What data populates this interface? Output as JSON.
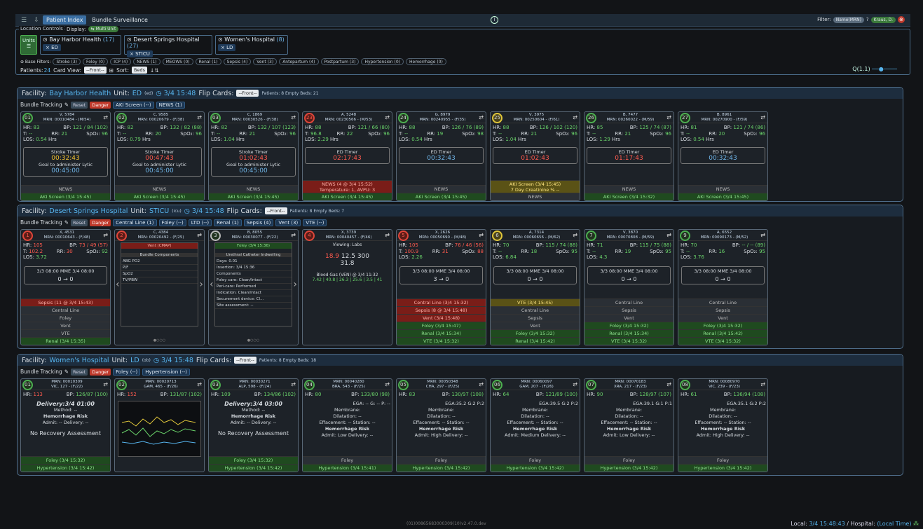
{
  "topbar": {
    "menu_icon": "hamburger-icon",
    "pin_icon": "pin-icon",
    "tab_patient": "Patient Index",
    "tab_bundle": "Bundle Surveillance",
    "info": "i",
    "filter_label": "Filter:",
    "filter_placeholder": "Name(MRN)",
    "help": "?",
    "user": "Kraus, D.",
    "close": "⊗"
  },
  "loc": {
    "legend": "Location Controls",
    "display_label": "Display:",
    "multi_unit": "⇆ Multi Unit",
    "units_label": "Units",
    "facilities": [
      {
        "name": "⊙ Bay Harbor Health",
        "count": "(17)",
        "unit": "× ED"
      },
      {
        "name": "⊙ Desert Springs Hospital",
        "count": "(27)",
        "unit": "× STICU"
      },
      {
        "name": "⊙ Women's Hospital",
        "count": "(8)",
        "unit": "× LD"
      }
    ],
    "base_filters_label": "⊕ Base Filters:",
    "filters": [
      "Stroke (3)",
      "Foley (0)",
      "ICP (4)",
      "NEWS (1)",
      "MEOWS (0)",
      "Renal (1)",
      "Sepsis (4)",
      "Vent (3)",
      "Antepartum (4)",
      "Postpartum (3)",
      "Hypertension (0)",
      "Hemorrhage (0)"
    ],
    "patients_label": "Patients:",
    "patients_count": "24",
    "card_view_label": "Card View:",
    "card_view": "--Front--",
    "sort_label": "Sort:",
    "sort": "Beds",
    "zoom": "Q(1.1)"
  },
  "fac1": {
    "label": "Facility:",
    "name": "Bay Harbor Health",
    "unit_label": "Unit:",
    "unit": "ED",
    "unit_code": "(ed)",
    "time": "◷ 3/4 15:48",
    "flip": "Flip Cards:",
    "flip_val": "--Front--",
    "meta": "Patients: 8 Empty Beds: 21",
    "bundle": "Bundle Tracking",
    "reset": "Reset",
    "danger": "Danger",
    "chips": [
      "AKI Screen (--)",
      "NEWS (1)"
    ],
    "cards": [
      {
        "bed": "01",
        "id": "V, 5784",
        "mrn": "MRN: 00010484 - (M/54)",
        "hr": "83",
        "bp": "121 / 84 (102)",
        "t": "--",
        "rr": "21",
        "spo2": "96",
        "los": "0.54",
        "timer_title": "Stroke Timer",
        "timer": "00:32:43",
        "goal": "Goal to administer Lytic",
        "goal_t": "00:45:00",
        "s1": "NEWS",
        "s2": "AKI Screen (3/4 15:45)"
      },
      {
        "bed": "02",
        "id": "C, 9585",
        "mrn": "MRN: 00020679 - (F/38)",
        "hr": "82",
        "bp": "132 / 82 (88)",
        "t": "--",
        "rr": "20",
        "spo2": "96",
        "los": "0.79",
        "timer_title": "Stroke Timer",
        "timer": "00:47:43",
        "goal": "Goal to administer Lytic",
        "goal_t": "00:45:00",
        "s1": "NEWS",
        "s2": "AKI Screen (3/4 15:45)"
      },
      {
        "bed": "03",
        "id": "C, 1869",
        "mrn": "MRN: 00030526 - (F/38)",
        "hr": "82",
        "bp": "132 / 107 (123)",
        "t": "--",
        "rr": "21",
        "spo2": "96",
        "los": "1.04",
        "timer_title": "Stroke Timer",
        "timer": "01:02:43",
        "goal": "Goal to administer Lytic",
        "goal_t": "00:45:00",
        "s1": "NEWS",
        "s2": "AKI Screen (3/4 15:45)"
      },
      {
        "bed": "23",
        "id": "A, 5248",
        "mrn": "MRN: 00230566 - (M/53)",
        "hr": "88",
        "bp": "121 / 66 (80)",
        "t": "96.8",
        "rr": "22",
        "spo2": "96",
        "los": "2.29",
        "timer_title": "ED Timer",
        "timer": "02:17:43",
        "goal": "",
        "goal_t": "",
        "s1": "NEWS (4 @ 3/4 15:52)",
        "s1b": "Temperature: 1, AVPU: 3",
        "s2": "AKI Screen (3/4 15:45)"
      },
      {
        "bed": "24",
        "id": "G, 8979",
        "mrn": "MRN: 00240955 - (F/35)",
        "hr": "88",
        "bp": "126 / 76 (89)",
        "t": "--",
        "rr": "19",
        "spo2": "98",
        "los": "0.54",
        "timer_title": "ED Timer",
        "timer": "00:32:43",
        "goal": "",
        "goal_t": "",
        "s1": "NEWS",
        "s2": "AKI Screen (3/4 15:45)"
      },
      {
        "bed": "25",
        "id": "V, 3975",
        "mrn": "MRN: 00250604 - (F/61)",
        "hr": "88",
        "bp": "126 / 102 (120)",
        "t": "--",
        "rr": "21",
        "spo2": "96",
        "los": "1.04",
        "timer_title": "ED Timer",
        "timer": "01:02:43",
        "goal": "",
        "goal_t": "",
        "s1": "AKI Screen (3/4 15:45)",
        "s1b": "7 Day Creatinine % --",
        "s2": "NEWS"
      },
      {
        "bed": "26",
        "id": "B, 7477",
        "mrn": "MRN: 00260022 - (M/59)",
        "hr": "85",
        "bp": "125 / 74 (87)",
        "t": "--",
        "rr": "21",
        "spo2": "96",
        "los": "1.29",
        "timer_title": "ED Timer",
        "timer": "01:17:43",
        "goal": "",
        "goal_t": "",
        "s1": "NEWS",
        "s2": "AKI Screen (3/4 15:32)"
      },
      {
        "bed": "27",
        "id": "B, 8961",
        "mrn": "MRN: 00270900 - (F/59)",
        "hr": "81",
        "bp": "121 / 74 (86)",
        "t": "--",
        "rr": "20",
        "spo2": "96",
        "los": "0.54",
        "timer_title": "ED Timer",
        "timer": "00:32:43",
        "goal": "",
        "goal_t": "",
        "s1": "NEWS",
        "s2": "AKI Screen (3/4 15:45)"
      }
    ]
  },
  "fac2": {
    "label": "Facility:",
    "name": "Desert Springs Hospital",
    "unit_label": "Unit:",
    "unit": "STICU",
    "unit_code": "(icu)",
    "time": "◷ 3/4 15:48",
    "flip": "Flip Cards:",
    "flip_val": "--Front--",
    "meta": "Patients: 8 Empty Beds: 7",
    "bundle": "Bundle Tracking",
    "reset": "Reset",
    "danger": "Danger",
    "chips": [
      "Central Line (1)",
      "Foley (--)",
      "LTD (--)",
      "Renal (1)",
      "Sepsis (4)",
      "Vent (3)",
      "VTE (--)"
    ],
    "cards": [
      {
        "bed": "1",
        "id": "X, 4531",
        "mrn": "MRN: 00010643 - (F/48)",
        "hr": "105",
        "bp": "73 / 49 (57)",
        "t": "102.2",
        "rr": "30",
        "spo2": "92",
        "los": "3.72",
        "mme": "3/3 08:00 MME 3/4 08:00",
        "mmev": "0 → 0",
        "rows": [
          "Sepsis (11 @ 3/4 15:43)",
          "Central Line",
          "Foley",
          "Vent",
          "VTE",
          "Renal (3/4 15:35)"
        ]
      },
      {
        "bed": "2",
        "id": "C, 4384",
        "mrn": "MRN: 00020492 - (F/25)",
        "panel": "Vent (CMAP)",
        "panel2": "Bundle Components",
        "rows": [
          "ABG PO2",
          "P/F",
          "SpO2",
          "TV/PBW"
        ]
      },
      {
        "bed": "3",
        "id": "B, 8055",
        "mrn": "MRN: 00030077 - (F/22)",
        "panel": "Foley (3/4 15:36)",
        "panel2": "Urethral Catheter Indwelling",
        "rows": [
          "Days: 0.01",
          "Insertion: 3/4 15:36",
          "Components",
          "Foley care: Clean/Intact",
          "Peri-care: Performed",
          "Indication: Clean/Intact",
          "Securement device: Cl...",
          "Site assessment: --"
        ]
      },
      {
        "bed": "4",
        "id": "X, 3739",
        "mrn": "MRN: 00040457 - (F/46)",
        "panel": "Viewing: Labs",
        "labs": [
          "18.9",
          "12.5",
          "300",
          "31.8"
        ],
        "labline": "Blood Gas (VEN) @ 3/4 11:32",
        "labvals": "7.42 | 40.8 | 26.3 | 25.6 | 3.5 | 41"
      },
      {
        "bed": "5",
        "id": "X, 2626",
        "mrn": "MRN: 00050690 - (M/48)",
        "hr": "105",
        "bp": "76 / 46 (56)",
        "t": "100.9",
        "rr": "31",
        "spo2": "88",
        "los": "2.26",
        "mme": "3/3 08:00 MME 3/4 08:00",
        "mmev": "3 → 0",
        "rows": [
          "Central Line (3/4 15:32)",
          "Sepsis (8 @ 3/4 15:48)",
          "Vent (3/4 15:48)",
          "Foley (3/4 15:47)",
          "Renal (3/4 15:34)",
          "VTE (3/4 15:32)"
        ]
      },
      {
        "bed": "6",
        "id": "A, 7314",
        "mrn": "MRN: 00060656 - (M/62)",
        "hr": "70",
        "bp": "115 / 74 (88)",
        "t": "--",
        "rr": "18",
        "spo2": "95",
        "los": "6.84",
        "mme": "3/3 08:00 MME 3/4 08:00",
        "mmev": "0 → 0",
        "rows": [
          "VTE (3/4 15:45)",
          "Central Line",
          "Sepsis",
          "Vent",
          "Foley (3/4 15:32)",
          "Renal (3/4 15:42)"
        ]
      },
      {
        "bed": "7",
        "id": "V, 3870",
        "mrn": "MRN: 00070808 - (M/59)",
        "hr": "71",
        "bp": "115 / 75 (88)",
        "t": "--",
        "rr": "19",
        "spo2": "95",
        "los": "4.3",
        "mme": "3/3 08:00 MME 3/4 08:00",
        "mmev": "0 → 0",
        "rows": [
          "Central Line",
          "Sepsis",
          "Vent",
          "Foley (3/4 15:32)",
          "Renal (3/4 15:34)",
          "VTE (3/4 15:32)"
        ]
      },
      {
        "bed": "9",
        "id": "A, 6552",
        "mrn": "MRN: 00090173 - (M/52)",
        "hr": "70",
        "bp": "-- / -- (89)",
        "t": "--",
        "rr": "16",
        "spo2": "95",
        "los": "3.76",
        "mme": "3/3 08:00 MME 3/4 08:00",
        "mmev": "0 → 0",
        "rows": [
          "Central Line",
          "Sepsis",
          "Vent",
          "Foley (3/4 15:32)",
          "Renal (3/4 15:42)",
          "VTE (3/4 15:32)"
        ]
      }
    ]
  },
  "fac3": {
    "label": "Facility:",
    "name": "Women's Hospital",
    "unit_label": "Unit:",
    "unit": "LD",
    "unit_code": "(ob)",
    "time": "◷ 3/4 15:48",
    "flip": "Flip Cards:",
    "flip_val": "--Front--",
    "meta": "Patients: 8 Empty Beds: 18",
    "bundle": "Bundle Tracking",
    "reset": "Reset",
    "danger": "Danger",
    "chips": [
      "Foley (--)",
      "Hypertension (--)"
    ],
    "cards": [
      {
        "bed": "01",
        "id": "MRN: 00010309",
        "sub": "VIC, 127 - (F/22)",
        "hr": "113",
        "bp": "126/87 (100)",
        "line": "Delivery:3/4 01:00",
        "rows": [
          "Method: --",
          "Hemorrhage Risk",
          "Admit: --  Delivery: --",
          "No Recovery Assessment"
        ],
        "s1": "Foley (3/4 15:32)",
        "s2": "Hypertension (3/4 15:42)"
      },
      {
        "bed": "02",
        "id": "MRN: 00020713",
        "sub": "GAM, 465 - (F/26)",
        "hr": "152",
        "bp": "131/87 (102)",
        "graph": true,
        "s1": "",
        "s2": ""
      },
      {
        "bed": "03",
        "id": "MRN: 00030271",
        "sub": "ALP, 598 - (F/24)",
        "hr": "109",
        "bp": "134/86 (102)",
        "line": "Delivery:3/4 03:00",
        "rows": [
          "Method: --",
          "Hemorrhage Risk",
          "Admit: --  Delivery: --",
          "No Recovery Assessment"
        ],
        "s1": "Foley (3/4 15:32)",
        "s2": "Hypertension (3/4 15:42)"
      },
      {
        "bed": "04",
        "id": "MRN: 00040280",
        "sub": "BRA, 543 - (F/25)",
        "hr": "80",
        "bp": "133/80 (98)",
        "ega": "EGA: --  G: --  P: --",
        "rows": [
          "Membrane:",
          "Dilatation: --",
          "Effacement: --  Station: --",
          "Hemorrhage Risk",
          "Admit: Low  Delivery: --"
        ],
        "s1": "Foley",
        "s2": "Hypertension (3/4 15:41)"
      },
      {
        "bed": "05",
        "id": "MRN: 00050348",
        "sub": "CHA, 297 - (F/25)",
        "hr": "83",
        "bp": "130/97 (108)",
        "ega": "EGA:35.2 G:2 P:2",
        "rows": [
          "Membrane:",
          "Dilatation: --",
          "Effacement: --  Station: --",
          "Hemorrhage Risk",
          "Admit: High  Delivery: --"
        ],
        "s1": "Foley",
        "s2": "Hypertension (3/4 15:42)"
      },
      {
        "bed": "06",
        "id": "MRN: 00060097",
        "sub": "GAM, 207 - (F/26)",
        "hr": "64",
        "bp": "121/89 (100)",
        "ega": "EGA:39.5 G:2 P:2",
        "rows": [
          "Membrane:",
          "Dilatation: --",
          "Effacement: --  Station: --",
          "Hemorrhage Risk",
          "Admit: Medium  Delivery: --"
        ],
        "s1": "Foley",
        "s2": "Hypertension (3/4 15:42)"
      },
      {
        "bed": "07",
        "id": "MRN: 00070183",
        "sub": "XRA, 217 - (F/23)",
        "hr": "90",
        "bp": "128/97 (107)",
        "ega": "EGA:39.1 G:1 P:1",
        "rows": [
          "Membrane:",
          "Dilatation: --",
          "Effacement: --  Station: --",
          "Hemorrhage Risk",
          "Admit: Low  Delivery: --"
        ],
        "s1": "Foley",
        "s2": "Hypertension (3/4 15:42)"
      },
      {
        "bed": "08",
        "id": "MRN: 00080970",
        "sub": "VIC, 239 - (F/23)",
        "hr": "61",
        "bp": "136/94 (108)",
        "ega": "EGA:35.1 G:2 P:2",
        "rows": [
          "Membrane:",
          "Dilatation: --",
          "Effacement: --  Station: --",
          "Hemorrhage Risk",
          "Admit: High  Delivery: --"
        ],
        "s1": "Foley",
        "s2": "Hypertension (3/4 15:42)"
      }
    ]
  },
  "footer": {
    "build": "(01)00865683000309(10)v2.47.0.dev",
    "local_label": "Local:",
    "local_time": "3/4 15:48:43",
    "hospital_label": "/ Hospital:",
    "hospital_time": "(Local Time)"
  }
}
